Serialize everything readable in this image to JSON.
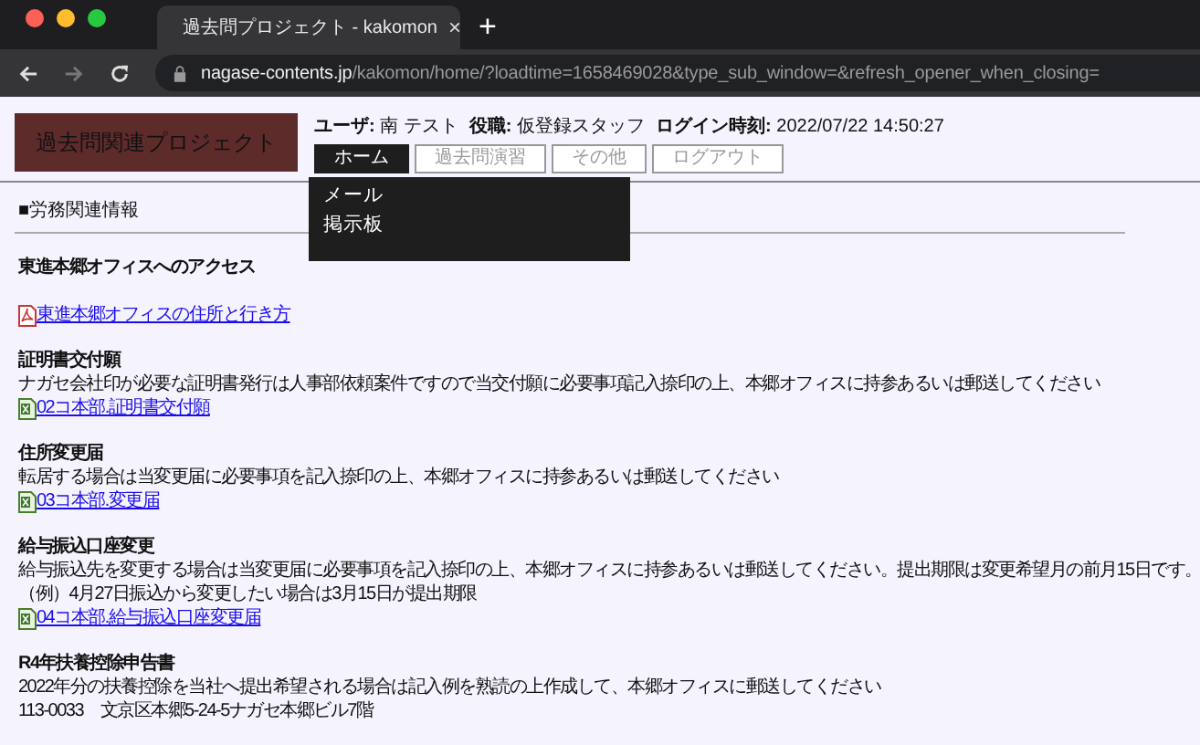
{
  "browser": {
    "tab_title": "過去問プロジェクト - kakomon",
    "close": "×",
    "new_tab": "+",
    "url_host": "nagase-contents.jp",
    "url_path": "/kakomon/home/?loadtime=1658469028&type_sub_window=&refresh_opener_when_closing="
  },
  "logo": "過去問関連プロジェクト",
  "user_info": [
    {
      "label": "ユーザ:",
      "value": "南 テスト"
    },
    {
      "label": "役職:",
      "value": "仮登録スタッフ"
    },
    {
      "label": "ログイン時刻:",
      "value": "2022/07/22 14:50:27"
    }
  ],
  "nav": [
    {
      "label": "ホーム",
      "selected": true
    },
    {
      "label": "過去問演習",
      "selected": false
    },
    {
      "label": "その他",
      "selected": false
    },
    {
      "label": "ログアウト",
      "selected": false
    }
  ],
  "dropdown": [
    "メール",
    "掲示板"
  ],
  "heading": "■労務関連情報",
  "sections": [
    {
      "title": "東進本郷オフィスへのアクセス",
      "link": {
        "kind": "pdf",
        "label": "東進本郷オフィスの住所と行き方"
      }
    },
    {
      "title": "証明書交付願",
      "lines": [
        "ナガセ会社印が必要な証明書発行は人事部依頼案件ですので当交付願に必要事項記入捺印の上、本郷オフィスに持参あるいは郵送してください"
      ],
      "link": {
        "kind": "excel",
        "label": "02コ本部.証明書交付願"
      }
    },
    {
      "title": "住所変更届",
      "lines": [
        "転居する場合は当変更届に必要事項を記入捺印の上、本郷オフィスに持参あるいは郵送してください"
      ],
      "link": {
        "kind": "excel",
        "label": "03コ本部.変更届"
      }
    },
    {
      "title": "給与振込口座変更",
      "lines": [
        "給与振込先を変更する場合は当変更届に必要事項を記入捺印の上、本郷オフィスに持参あるいは郵送してください。提出期限は変更希望月の前月15日です。",
        "（例）4月27日振込から変更したい場合は3月15日が提出期限"
      ],
      "link": {
        "kind": "excel",
        "label": "04コ本部.給与振込口座変更届"
      }
    },
    {
      "title": "R4年扶養控除申告書",
      "lines": [
        "2022年分の扶養控除を当社へ提出希望される場合は記入例を熟読の上作成して、本郷オフィスに郵送してください",
        "113-0033　文京区本郷5-24-5ナガセ本郷ビル7階"
      ]
    }
  ]
}
